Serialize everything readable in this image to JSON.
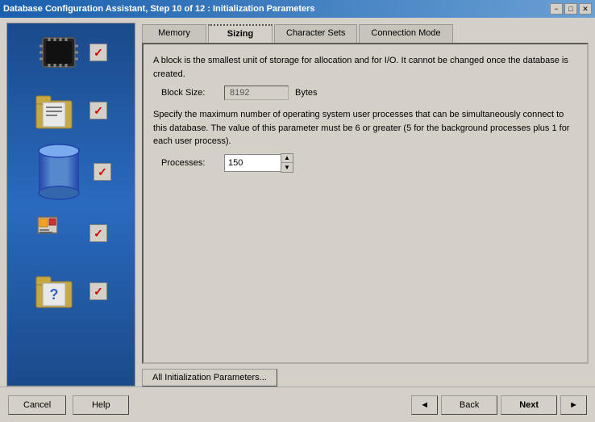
{
  "titlebar": {
    "text": "Database Configuration Assistant, Step 10 of 12 : Initialization Parameters",
    "minimize": "−",
    "maximize": "□",
    "close": "✕"
  },
  "tabs": [
    {
      "id": "memory",
      "label": "Memory",
      "active": false,
      "dotted": false
    },
    {
      "id": "sizing",
      "label": "Sizing",
      "active": true,
      "dotted": true
    },
    {
      "id": "charsets",
      "label": "Character Sets",
      "active": false,
      "dotted": false
    },
    {
      "id": "connmode",
      "label": "Connection Mode",
      "active": false,
      "dotted": false
    }
  ],
  "sizing": {
    "block_size_desc": "A block is the smallest unit of storage for allocation and for I/O. It cannot be changed once the database is created.",
    "block_size_label": "Block Size:",
    "block_size_value": "8192",
    "block_size_unit": "Bytes",
    "processes_desc": "Specify the maximum number of operating system user processes that can be simultaneously connect to this database. The value of this parameter must be 6 or greater (5 for the background processes plus 1 for each user process).",
    "processes_label": "Processes:",
    "processes_value": "150"
  },
  "buttons": {
    "all_params": "All Initialization Parameters...",
    "cancel": "Cancel",
    "help": "Help",
    "back": "Back",
    "next": "Next",
    "back_arrow": "◄",
    "next_arrow": "►"
  },
  "icons": {
    "chip": "chip-icon",
    "folder_docs": "folder-docs-icon",
    "database": "database-icon",
    "shapes": "shapes-icon",
    "folder_question": "folder-question-icon"
  }
}
